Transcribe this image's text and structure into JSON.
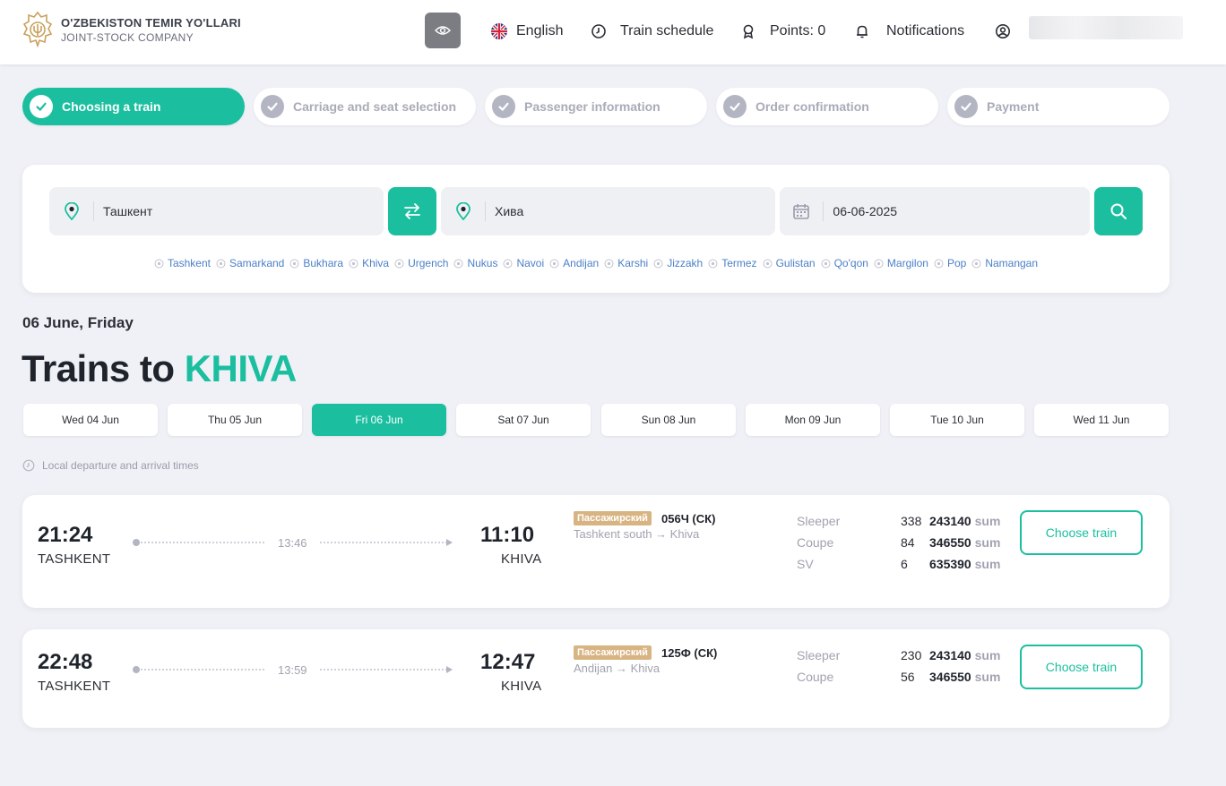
{
  "header": {
    "brand_title": "O'ZBEKISTON TEMIR YO'LLARI",
    "brand_sub": "JOINT-STOCK COMPANY",
    "language": "English",
    "train_schedule": "Train schedule",
    "points": "Points: 0",
    "notifications": "Notifications"
  },
  "steps": [
    {
      "label": "Choosing a train",
      "active": true
    },
    {
      "label": "Carriage and seat selection",
      "active": false
    },
    {
      "label": "Passenger information",
      "active": false
    },
    {
      "label": "Order confirmation",
      "active": false
    },
    {
      "label": "Payment",
      "active": false
    }
  ],
  "search": {
    "from": "Ташкент",
    "to": "Хива",
    "date": "06-06-2025"
  },
  "cities": [
    "Tashkent",
    "Samarkand",
    "Bukhara",
    "Khiva",
    "Urgench",
    "Nukus",
    "Navoi",
    "Andijan",
    "Karshi",
    "Jizzakh",
    "Termez",
    "Gulistan",
    "Qo'qon",
    "Margilon",
    "Pop",
    "Namangan"
  ],
  "date_title": "06 June, Friday",
  "trains_title": {
    "prefix": "Trains to",
    "destination": "KHIVA"
  },
  "days": [
    {
      "label": "Wed 04 Jun",
      "active": false
    },
    {
      "label": "Thu 05 Jun",
      "active": false
    },
    {
      "label": "Fri 06 Jun",
      "active": true
    },
    {
      "label": "Sat 07 Jun",
      "active": false
    },
    {
      "label": "Sun 08 Jun",
      "active": false
    },
    {
      "label": "Mon 09 Jun",
      "active": false
    },
    {
      "label": "Tue 10 Jun",
      "active": false
    },
    {
      "label": "Wed 11 Jun",
      "active": false
    }
  ],
  "local_note": "Local departure and arrival times",
  "trains": [
    {
      "departure_time": "21:24",
      "departure_city": "TASHKENT",
      "duration": "13:46",
      "arrival_time": "11:10",
      "arrival_city": "KHIVA",
      "badge": "Пассажирский",
      "number": "056Ч (СК)",
      "route": "Tashkent south → Khiva",
      "seats": [
        {
          "type": "Sleeper",
          "count": "338",
          "price": "243140",
          "currency": "sum"
        },
        {
          "type": "Coupe",
          "count": "84",
          "price": "346550",
          "currency": "sum"
        },
        {
          "type": "SV",
          "count": "6",
          "price": "635390",
          "currency": "sum"
        }
      ],
      "button": "Choose train"
    },
    {
      "departure_time": "22:48",
      "departure_city": "TASHKENT",
      "duration": "13:59",
      "arrival_time": "12:47",
      "arrival_city": "KHIVA",
      "badge": "Пассажирский",
      "number": "125Ф (СК)",
      "route": "Andijan → Khiva",
      "seats": [
        {
          "type": "Sleeper",
          "count": "230",
          "price": "243140",
          "currency": "sum"
        },
        {
          "type": "Coupe",
          "count": "56",
          "price": "346550",
          "currency": "sum"
        }
      ],
      "button": "Choose train"
    }
  ],
  "colors": {
    "accent": "#1bbf9f",
    "badge": "#d9b483",
    "link": "#4b7fc8"
  }
}
